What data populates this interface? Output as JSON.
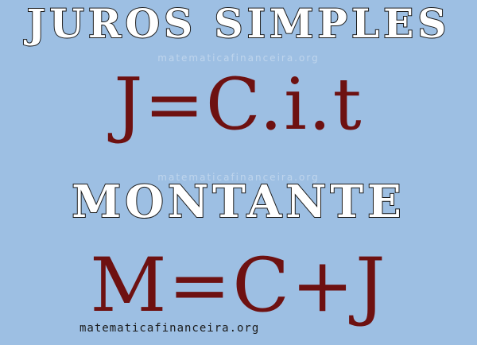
{
  "title_simple_interest": "JUROS SIMPLES",
  "formula_simple_interest": "J=C.i.t",
  "title_amount": "MONTANTE",
  "formula_amount": "M=C+J",
  "watermark_top": "matematicafinanceira.org",
  "watermark_middle": "matematicafinanceira.org",
  "site_caption": "matematicafinanceira.org",
  "colors": {
    "background": "#9dbfe3",
    "formula": "#6e1111",
    "title_fill": "#ffffff",
    "title_outline": "#1a1a1a"
  }
}
